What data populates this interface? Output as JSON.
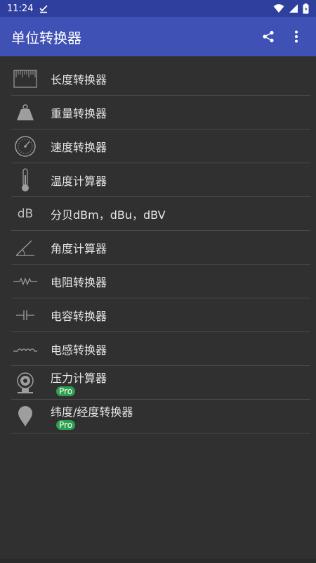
{
  "status": {
    "time": "11:24"
  },
  "appbar": {
    "title": "单位转换器"
  },
  "items": [
    {
      "label": "长度转换器",
      "icon": "ruler-icon"
    },
    {
      "label": "重量转换器",
      "icon": "weight-icon"
    },
    {
      "label": "速度转换器",
      "icon": "speedometer-icon"
    },
    {
      "label": "温度计算器",
      "icon": "thermometer-icon"
    },
    {
      "label": "分贝dBm，dBu，dBV",
      "icon": "decibel-icon",
      "icon_text": "dB"
    },
    {
      "label": "角度计算器",
      "icon": "angle-icon"
    },
    {
      "label": "电阻转换器",
      "icon": "resistor-icon"
    },
    {
      "label": "电容转换器",
      "icon": "capacitor-icon"
    },
    {
      "label": "电感转换器",
      "icon": "inductor-icon"
    },
    {
      "label": "压力计算器",
      "icon": "pressure-gauge-icon",
      "badge": "Pro"
    },
    {
      "label": "纬度/经度转换器",
      "icon": "location-pin-icon",
      "badge": "Pro"
    }
  ]
}
